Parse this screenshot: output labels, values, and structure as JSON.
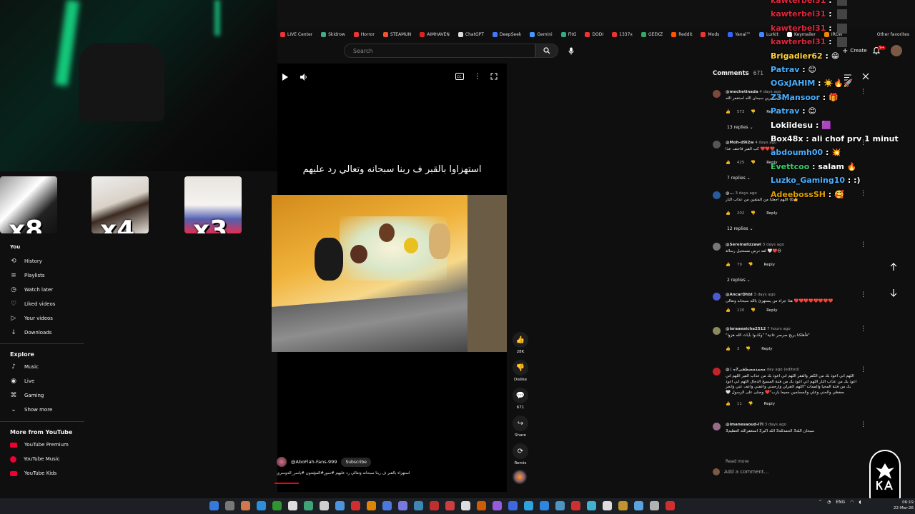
{
  "browser": {
    "bookmarks": [
      "LIVE Center",
      "Skidrow",
      "Horror",
      "STEAMUN",
      "AIMHAVEN",
      "ChatGPT",
      "DeepSeek",
      "Gemini",
      "FitG",
      "DODI",
      "1337x",
      "GEEKZ",
      "Reddit",
      "Mods",
      "Yanal™",
      "Lurkit",
      "Keymailer",
      "IRON"
    ],
    "other_favorites": "Other favorites"
  },
  "yt": {
    "search_placeholder": "Search",
    "create_label": "Create",
    "notif_badge": "9+"
  },
  "nav": {
    "you_label": "You",
    "items": [
      "History",
      "Playlists",
      "Watch later",
      "Liked videos",
      "Your videos",
      "Downloads"
    ],
    "explore_label": "Explore",
    "explore_items": [
      "Music",
      "Live",
      "Gaming",
      "Show more"
    ],
    "more_label": "More from YouTube",
    "more_items": [
      "YouTube Premium",
      "YouTube Music",
      "YouTube Kids"
    ]
  },
  "overlay": {
    "multipliers": [
      "x8",
      "x4",
      "x3"
    ]
  },
  "video": {
    "caption": "استهزاوا بالقبر ف ربنا سبحانه وتعالي رد عليهم",
    "channel": "@AboFlah-Fans-999",
    "subscribe": "Subscribe",
    "title": "استهزاء بالقبر ف ربنا سبحانه وتعالي رد عليهم #سور#المؤمنون #ياسر_الدوسري"
  },
  "actions": {
    "likes": "28K",
    "dislike": "Dislike",
    "comments": "671",
    "share": "Share",
    "remix": "Remix"
  },
  "comments": {
    "title": "Comments",
    "count": "671",
    "add_placeholder": "Add a comment...",
    "list": [
      {
        "user": "@mechetinada",
        "time": "4 days ago",
        "text": "هذا هو جزاء المتكبرين سبحان الله استغفر الله",
        "likes": "573",
        "reply": "Reply",
        "replies": "13 replies",
        "color": "#7a4a3a"
      },
      {
        "user": "@Moh-d9i2w",
        "time": "4 days ago",
        "text": "❤️❤️❤️ كب القبر فاحتف عذا",
        "likes": "425",
        "reply": "Reply",
        "replies": "7 replies",
        "color": "#555"
      },
      {
        "user": "@...",
        "time": "3 days ago",
        "text": "👍😡 اللهم اجعلنا من المتقين من عذاب النار",
        "likes": "202",
        "reply": "Reply",
        "replies": "12 replies",
        "color": "#2a5a9a"
      },
      {
        "user": "@Sereinalizzawi",
        "time": "3 days ago",
        "text": "😢❤️🤍 لقد درس مستحيل رسالة",
        "likes": "79",
        "reply": "Reply",
        "replies": "2 replies",
        "color": "#777"
      },
      {
        "user": "@AncarDhbl",
        "time": "3 days ago",
        "text": "❤️❤️❤️❤️❤️❤️❤️❤️ هذا جزاء من يستهزئ بالله سبحانه وتعالى",
        "likes": "120",
        "reply": "Reply",
        "replies": "",
        "color": "#4a5ad0"
      },
      {
        "user": "@israaeaicha2512",
        "time": "7 hours ago",
        "text": "\"فأهلكنا بريح صرصر عاتية\" \"وكذبوا بآيات الله هزوا\"",
        "likes": "3",
        "reply": "Reply",
        "replies": "",
        "color": "#8a8a5a"
      },
      {
        "user": "@محمدمصطفى7ه",
        "time": "1 day ago (edited)",
        "text": "اللهم اني اعوذ بك من الكفر والفقر اللهم اني اعوذ بك من عذاب القبر اللهم اني اعوذ بك من عذاب النار اللهم اني اعوذ بك من فتنة المسيح الدجال اللهم اني اعوذ بك من فتنة المحيا والممات \"اللهم اغفرلي وارحمني واعفني واعف عني وانجز بحفظي والحني وعلي والمسلمين جميعا يارب\"❤️ وصلى على الرسول 🤍",
        "likes": "11",
        "reply": "Reply",
        "replies": "",
        "color": "#c0242a"
      },
      {
        "user": "@imanesaoud-l7i",
        "time": "3 days ago",
        "text": "سبحان الله3 الحمدلله3 الله اكبر3 استغفرالله العظيم3",
        "likes": "",
        "reply": "",
        "replies": "",
        "color": "#9a6a8a"
      }
    ],
    "read_more": "Read more"
  },
  "chat": {
    "lines": [
      {
        "user": "kawterbel31",
        "msg": "",
        "color": "#e0263c"
      },
      {
        "user": "kawterbel31",
        "msg": "",
        "color": "#e0263c"
      },
      {
        "user": "kawterbel31",
        "msg": "",
        "color": "#e0263c"
      },
      {
        "user": "kawterbel31",
        "msg": "",
        "color": "#e0263c"
      },
      {
        "user": "Brigadier62",
        "msg": "😁",
        "color": "#ffd23a"
      },
      {
        "user": "Patrav",
        "msg": "😊",
        "color": "#4ab0ff"
      },
      {
        "user": "OGxJAHIM",
        "msg": "☀️🔥🚀",
        "color": "#4ab0ff"
      },
      {
        "user": "Z3Mansoor",
        "msg": "🎁",
        "color": "#4ab0ff"
      },
      {
        "user": "Patrav",
        "msg": "😊",
        "color": "#4ab0ff"
      },
      {
        "user": "Lokiidesu",
        "msg": "🟪",
        "color": "#ffffff"
      },
      {
        "user": "Box48x",
        "msg": "ali chof prv 1 minut",
        "color": "#ffffff"
      },
      {
        "user": "abdoumh00",
        "msg": "💥",
        "color": "#4ab0ff"
      },
      {
        "user": "Evettcoo",
        "msg": "salam 🔥",
        "color": "#3ad06a"
      },
      {
        "user": "Luzko_Gaming10",
        "msg": ":)",
        "color": "#4ab0ff"
      },
      {
        "user": "AdeebossSH",
        "msg": "🥰",
        "color": "#e0a000"
      }
    ]
  },
  "taskbar": {
    "lang": "ENG",
    "time": "06:19",
    "date": "22-Mar-26"
  }
}
